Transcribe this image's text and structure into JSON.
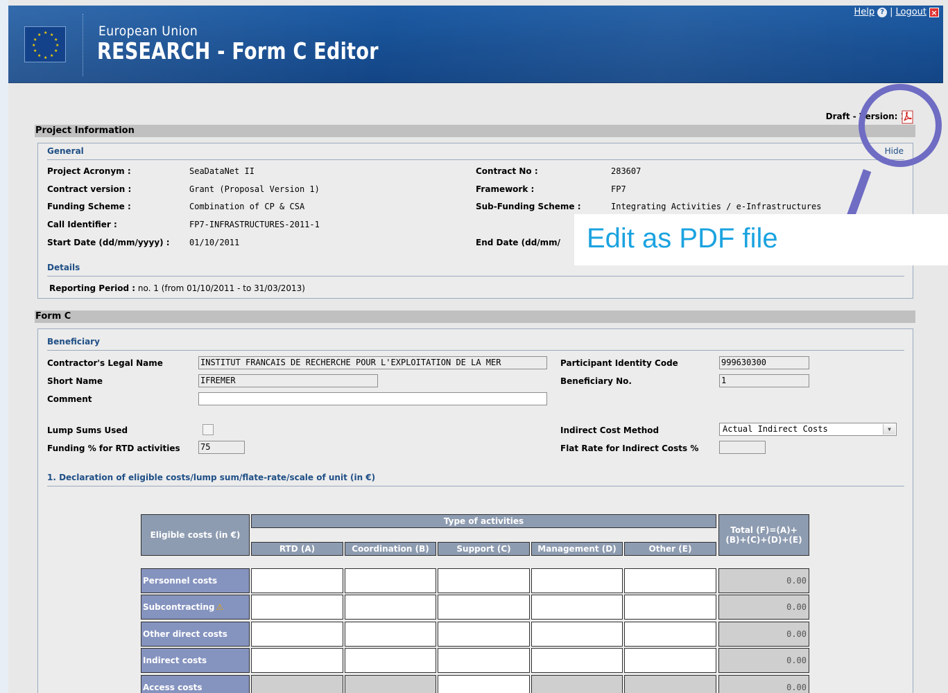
{
  "header": {
    "subtitle": "European Union",
    "app_title": "RESEARCH - Form C Editor",
    "help_label": "Help",
    "separator": "|",
    "logout_label": "Logout"
  },
  "status": {
    "draft_version": "Draft - Version: 1"
  },
  "project_info": {
    "section_title": "Project Information",
    "general_title": "General",
    "hide_label": "Hide",
    "fields_left": [
      {
        "label": "Project Acronym :",
        "value": "SeaDataNet II"
      },
      {
        "label": "Contract version :",
        "value": "Grant (Proposal Version 1)"
      },
      {
        "label": "Funding Scheme :",
        "value": "Combination of CP & CSA"
      },
      {
        "label": "Call Identifier :",
        "value": "FP7-INFRASTRUCTURES-2011-1"
      },
      {
        "label": "Start Date (dd/mm/yyyy) :",
        "value": "01/10/2011"
      }
    ],
    "fields_right": [
      {
        "label": "Contract No :",
        "value": "283607"
      },
      {
        "label": "Framework :",
        "value": "FP7"
      },
      {
        "label": "Sub-Funding Scheme :",
        "value": "Integrating Activities / e-Infrastructures"
      },
      {
        "label": "End Date (dd/mm/",
        "value": ""
      }
    ],
    "details_title": "Details",
    "reporting_period_label": "Reporting Period :",
    "reporting_period_value": "no. 1 (from 01/10/2011 - to 31/03/2013)"
  },
  "form_c": {
    "section_title": "Form C",
    "beneficiary_title": "Beneficiary",
    "legal_name_label": "Contractor's Legal Name",
    "legal_name_value": "INSTITUT FRANCAIS DE RECHERCHE POUR L'EXPLOITATION DE LA MER",
    "short_name_label": "Short Name",
    "short_name_value": "IFREMER",
    "comment_label": "Comment",
    "comment_value": "",
    "pic_label": "Participant Identity Code",
    "pic_value": "999630300",
    "beneficiary_no_label": "Beneficiary No.",
    "beneficiary_no_value": "1",
    "lump_sums_label": "Lump Sums Used",
    "lump_sums_checked": false,
    "funding_label": "Funding % for RTD activities",
    "funding_value": "75",
    "indirect_method_label": "Indirect Cost Method",
    "indirect_method_value": "Actual Indirect Costs",
    "flat_rate_label": "Flat Rate for Indirect Costs %",
    "flat_rate_value": "",
    "declaration_title": "1. Declaration of eligible costs/lump sum/flate-rate/scale of unit (in €)"
  },
  "cost_table": {
    "eligible_header": "Eligible costs (in €)",
    "type_header": "Type of activities",
    "total_header": "Total (F)=(A)+(B)+(C)+(D)+(E)",
    "columns": [
      "RTD (A)",
      "Coordination (B)",
      "Support (C)",
      "Management (D)",
      "Other (E)"
    ],
    "rows": [
      {
        "label": "Personnel costs",
        "total": "0.00",
        "warning": false,
        "editable": [
          true,
          true,
          true,
          true,
          true
        ]
      },
      {
        "label": "Subcontracting",
        "total": "0.00",
        "warning": true,
        "editable": [
          true,
          true,
          true,
          true,
          true
        ]
      },
      {
        "label": "Other direct costs",
        "total": "0.00",
        "warning": false,
        "editable": [
          true,
          true,
          true,
          true,
          true
        ]
      },
      {
        "label": "Indirect costs",
        "total": "0.00",
        "warning": false,
        "editable": [
          true,
          true,
          true,
          true,
          true
        ]
      },
      {
        "label": "Access costs",
        "total": "0.00",
        "warning": false,
        "editable": [
          false,
          false,
          true,
          false,
          false
        ]
      }
    ]
  },
  "callout": {
    "text": "Edit as PDF file",
    "color": "#1ba3e0",
    "ring_color": "#6f6cc4"
  }
}
